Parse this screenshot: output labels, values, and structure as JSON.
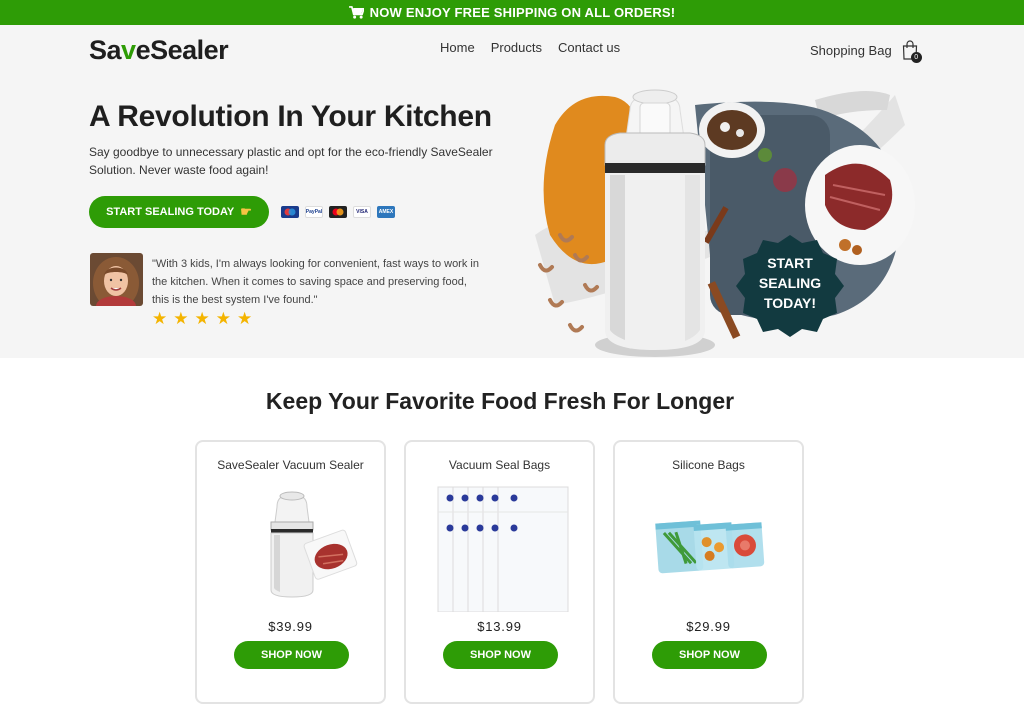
{
  "announcement": {
    "icon": "cart-icon",
    "text": "NOW ENJOY FREE SHIPPING ON ALL ORDERS!",
    "bg_color": "#2e9c06"
  },
  "header": {
    "logo_part1": "Sa",
    "logo_accent": "v",
    "logo_part2": "eSealer",
    "nav": [
      "Home",
      "Products",
      "Contact us"
    ],
    "bag_label": "Shopping Bag",
    "bag_count": "0"
  },
  "hero": {
    "title": "A Revolution In Your Kitchen",
    "subtitle": "Say goodbye to unnecessary plastic and opt for the eco-friendly SaveSealer Solution. Never waste food again!",
    "cta_label": "START SEALING TODAY",
    "cta_icon": "pointing-hand-icon",
    "payment_icons": [
      "maestro-icon",
      "paypal-icon",
      "mastercard-icon",
      "visa-icon",
      "amex-icon"
    ],
    "payment_labels": [
      "",
      "PayPal",
      "",
      "VISA",
      "AMEX"
    ],
    "testimonial": "\"With 3 kids, I'm always looking for convenient, fast ways to work in the kitchen. When it comes to saving space and preserving food, this is the best system I've found.\"",
    "rating": 5,
    "badge_line1": "START",
    "badge_line2": "SEALING",
    "badge_line3": "TODAY!"
  },
  "products_section": {
    "title": "Keep Your Favorite Food Fresh For Longer",
    "products": [
      {
        "name": "SaveSealer Vacuum Sealer",
        "price": "$39.99",
        "button": "SHOP NOW"
      },
      {
        "name": "Vacuum Seal Bags",
        "price": "$13.99",
        "button": "SHOP NOW"
      },
      {
        "name": "Silicone Bags",
        "price": "$29.99",
        "button": "SHOP NOW"
      }
    ]
  },
  "colors": {
    "brand_green": "#2e9c06",
    "hero_bg": "#f5f5f5",
    "orange_blob": "#e08a1e",
    "badge_dark": "#123a40",
    "star": "#f4b400"
  }
}
